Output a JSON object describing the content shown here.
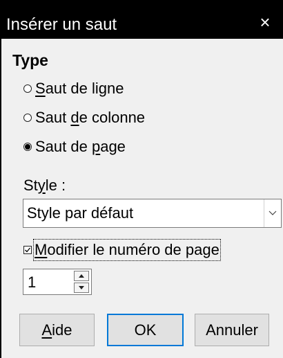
{
  "dialog": {
    "title": "Insérer un saut",
    "close_glyph": "×"
  },
  "type_section": {
    "heading": "Type",
    "options": [
      {
        "u_pre": "",
        "u_char": "S",
        "u_post": "aut de ligne",
        "checked": false
      },
      {
        "u_pre": "Saut ",
        "u_char": "d",
        "u_post": "e colonne",
        "checked": false
      },
      {
        "u_pre": "Saut de ",
        "u_char": "p",
        "u_post": "age",
        "checked": true
      }
    ]
  },
  "style": {
    "label_pre": "St",
    "label_u": "y",
    "label_post": "le :",
    "selected": "Style par défaut"
  },
  "page_number": {
    "checkbox_u": "M",
    "checkbox_rest": "odifier le numéro de page",
    "checked": true,
    "value": "1"
  },
  "buttons": {
    "help_u": "A",
    "help_rest": "ide",
    "ok": "OK",
    "cancel": "Annuler"
  },
  "icons": {
    "close": "close-icon",
    "dropdown": "chevron-down-icon",
    "checkbox": "checkmark-icon",
    "spin_up": "triangle-up-icon",
    "spin_down": "triangle-down-icon"
  },
  "colors": {
    "titlebar_bg": "#000000",
    "dialog_bg": "#f0f0f0",
    "default_button_border": "#0078d7"
  }
}
